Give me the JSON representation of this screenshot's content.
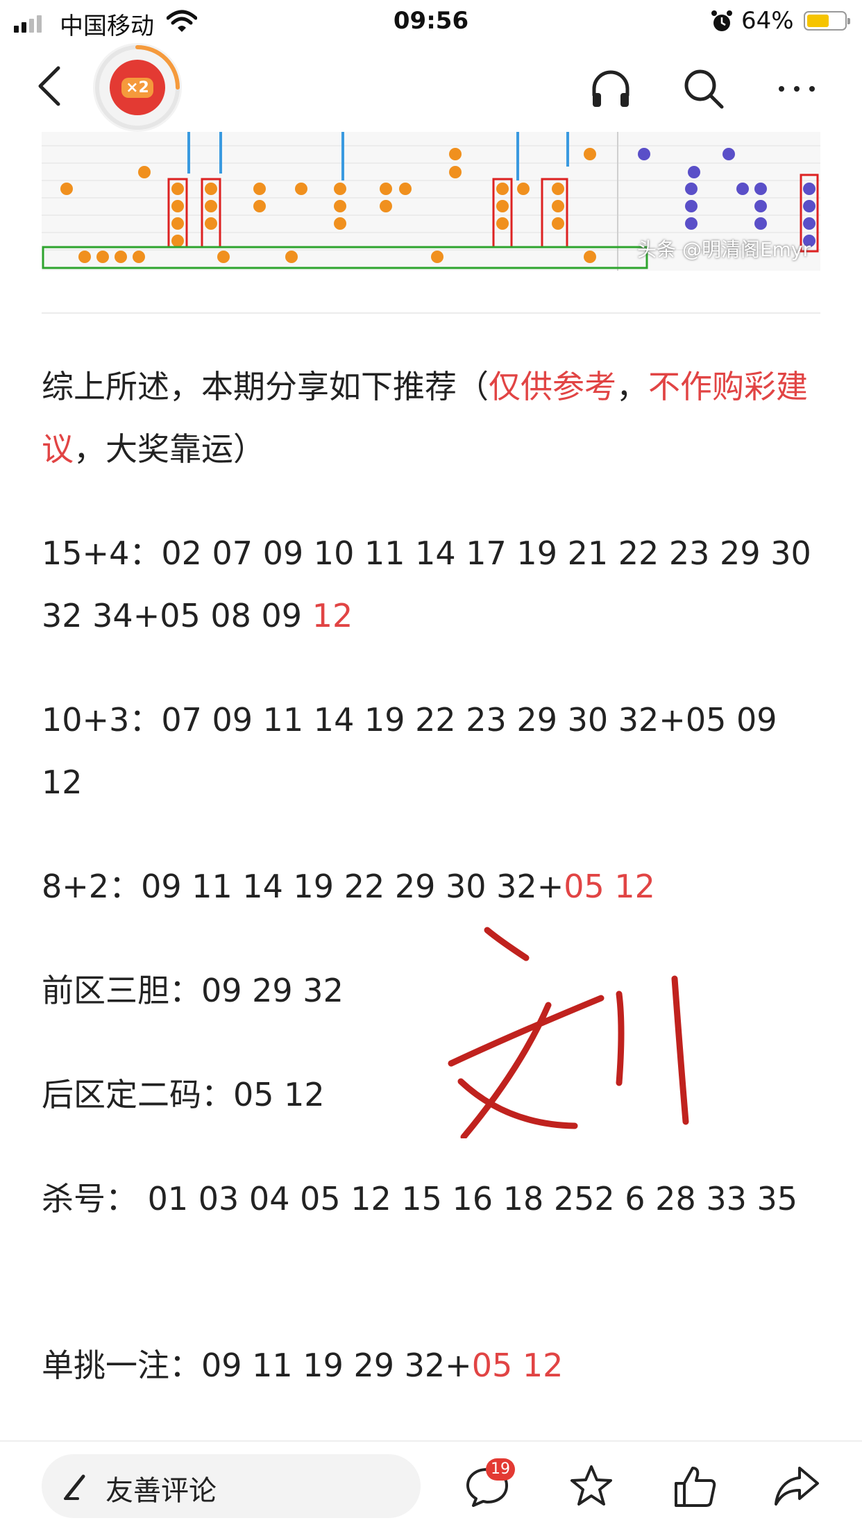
{
  "status_bar": {
    "carrier": "中国移动",
    "time": "09:56",
    "battery_percent": "64%",
    "battery_level": 0.64,
    "battery_color": "#f6c400"
  },
  "nav": {
    "badge_label": "×2",
    "icons": [
      "back-icon",
      "headphones-icon",
      "search-icon",
      "more-icon"
    ]
  },
  "image": {
    "watermark": "头条 @明清阁Emyr"
  },
  "article": {
    "intro_prefix": "综上所述，本期分享如下推荐（",
    "intro_red1": "仅供参考",
    "intro_comma": "，",
    "intro_red2": "不作购彩建议",
    "intro_suffix": "，大奖靠运）",
    "line1_prefix": "15+4：02 07 09 10 11 14 17 19 21 22 23 29 30 32 34+05 08 09 ",
    "line1_red": "12",
    "line2": "10+3：07 09 11 14 19 22 23 29 30 32+05 09 12",
    "line3_prefix": "8+2：09 11 14 19 22 29 30 32+",
    "line3_red": "05 12",
    "line4": "前区三胆：09 29 32",
    "line5": "后区定二码：05 12",
    "line6": "杀号： 01 03 04 05 12 15 16 18 252 6 28 33 35",
    "line7_prefix": "单挑一注：09 11 19 29 32+",
    "line7_red": "05 12"
  },
  "bottom_bar": {
    "comment_placeholder": "友善评论",
    "comment_count": "19",
    "icons": [
      "pen-icon",
      "comment-icon",
      "star-icon",
      "like-icon",
      "share-icon"
    ]
  },
  "colors": {
    "accent_red": "#e14444",
    "handwriting": "#c0221e",
    "chart_orange": "#f0901e",
    "chart_purple": "#5a4fc8",
    "chart_blue": "#3a9ae0"
  }
}
